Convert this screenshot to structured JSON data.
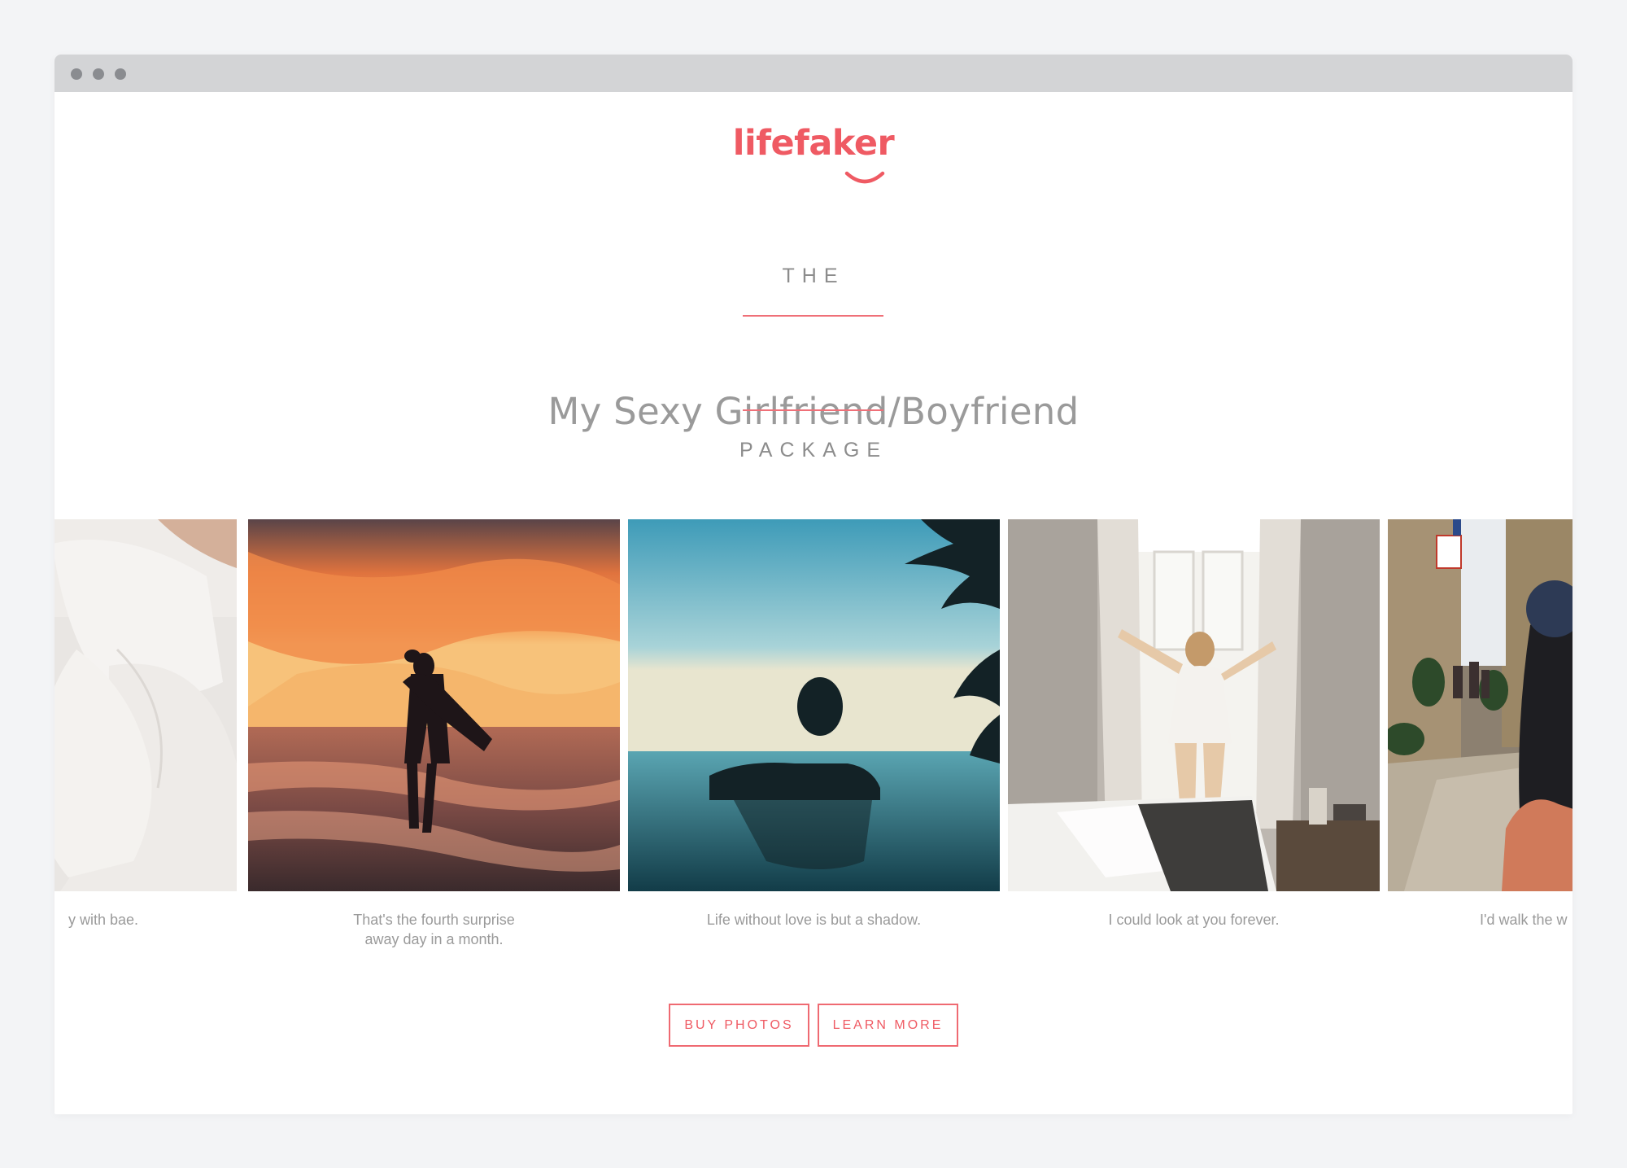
{
  "browser": {
    "window_controls": [
      "dot",
      "dot",
      "dot"
    ]
  },
  "brand": {
    "logo_text": "lifefaker",
    "accent_color": "#ef5a63"
  },
  "hero": {
    "eyebrow_top": "THE",
    "title": "My Sexy Girlfriend/Boyfriend",
    "eyebrow_bottom": "PACKAGE"
  },
  "carousel": {
    "slides": [
      {
        "caption": "y with bae.",
        "image": "woman-lying-in-bed-photo"
      },
      {
        "caption": "That's the fourth surprise away day in a month.",
        "image": "couple-on-beach-at-sunset-photo"
      },
      {
        "caption": "Life without love is but a shadow.",
        "image": "man-in-infinity-pool-photo"
      },
      {
        "caption": "I could look at you forever.",
        "image": "woman-at-bedroom-window-photo"
      },
      {
        "caption": "I'd walk the w",
        "image": "follow-me-street-photo"
      }
    ]
  },
  "actions": {
    "buy_label": "BUY PHOTOS",
    "learn_label": "LEARN MORE"
  }
}
